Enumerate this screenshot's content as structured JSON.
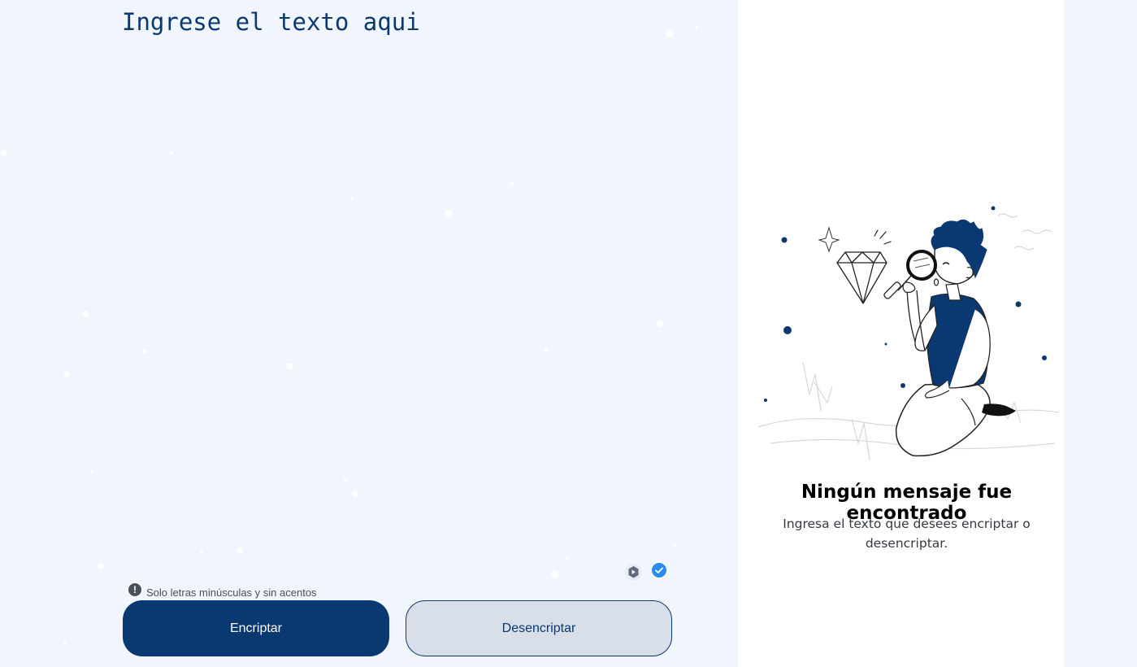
{
  "input": {
    "placeholder": "Ingrese el texto aqui"
  },
  "hint": {
    "icon": "exclamation-circle-icon",
    "text": "Solo letras minúsculas y sin acentos"
  },
  "buttons": {
    "encrypt_label": "Encriptar",
    "decrypt_label": "Desencriptar"
  },
  "output_panel": {
    "title": "Ningún mensaje fue encontrado",
    "message": "Ingresa el texto que desees encriptar o desencriptar."
  },
  "extension_icons": [
    "extension-hexagon-icon",
    "checkmark-badge-icon"
  ],
  "colors": {
    "page_background": "#f1f5fd",
    "primary": "#0a3871",
    "secondary_button_bg": "#d8dfe8",
    "panel_background": "#ffffff"
  }
}
